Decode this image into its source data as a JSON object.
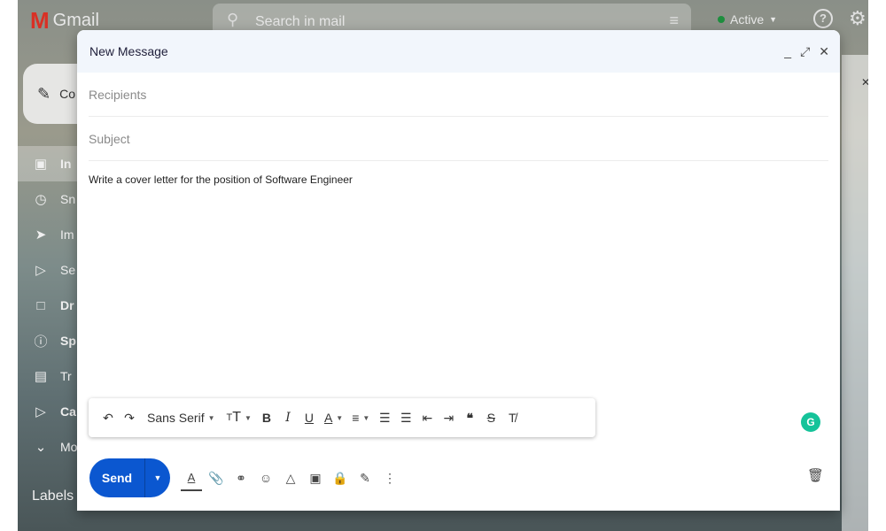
{
  "app": {
    "logo_text": "Gmail",
    "search_placeholder": "Search in mail",
    "status": "Active",
    "compose_label": "Co",
    "nav": [
      {
        "label": "In",
        "icon": "inbox-icon",
        "active": true
      },
      {
        "label": "Sn",
        "icon": "clock-icon"
      },
      {
        "label": "Im",
        "icon": "label-icon"
      },
      {
        "label": "Se",
        "icon": "send-icon"
      },
      {
        "label": "Dr",
        "icon": "draft-icon"
      },
      {
        "label": "Sp",
        "icon": "spam-icon"
      },
      {
        "label": "Tr",
        "icon": "trash-icon"
      },
      {
        "label": "Ca",
        "icon": "category-icon"
      },
      {
        "label": "Mo",
        "icon": "chevron-down-icon"
      }
    ],
    "labels_heading": "Labels"
  },
  "compose": {
    "title": "New Message",
    "recipients_placeholder": "Recipients",
    "subject_placeholder": "Subject",
    "body": "Write a cover letter for the position of Software Engineer",
    "font": "Sans Serif",
    "send_label": "Send",
    "grammarly": "G"
  },
  "colors": {
    "accent": "#0b57d0",
    "header_bg": "#f2f6fc",
    "grammarly": "#15c39a"
  }
}
